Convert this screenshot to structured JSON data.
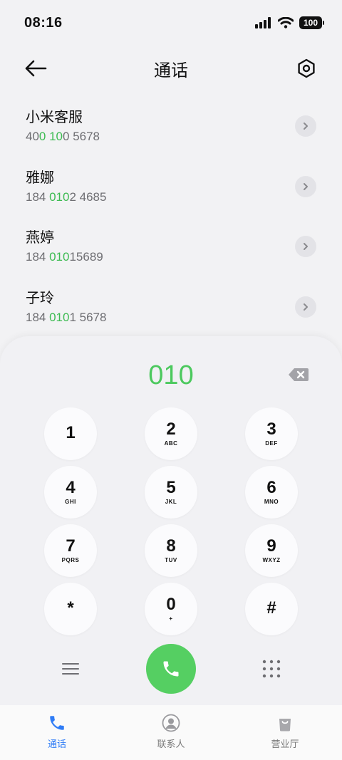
{
  "status_bar": {
    "time": "08:16",
    "battery": "100"
  },
  "header": {
    "title": "通话"
  },
  "contacts": [
    {
      "name": "小米客服",
      "number_parts": [
        "40",
        "0 10",
        "0 5678"
      ]
    },
    {
      "name": "雅娜",
      "number_parts": [
        "184 ",
        "010",
        "2 4685"
      ]
    },
    {
      "name": "燕婷",
      "number_parts": [
        "184 ",
        "010",
        "15689"
      ]
    },
    {
      "name": "子玲",
      "number_parts": [
        "184 ",
        "010",
        "1 5678"
      ]
    }
  ],
  "dialer": {
    "display": "010",
    "keys": [
      {
        "digit": "1",
        "letters": ""
      },
      {
        "digit": "2",
        "letters": "ABC"
      },
      {
        "digit": "3",
        "letters": "DEF"
      },
      {
        "digit": "4",
        "letters": "GHI"
      },
      {
        "digit": "5",
        "letters": "JKL"
      },
      {
        "digit": "6",
        "letters": "MNO"
      },
      {
        "digit": "7",
        "letters": "PQRS"
      },
      {
        "digit": "8",
        "letters": "TUV"
      },
      {
        "digit": "9",
        "letters": "WXYZ"
      },
      {
        "digit": "*",
        "letters": ""
      },
      {
        "digit": "0",
        "letters": "+"
      },
      {
        "digit": "#",
        "letters": ""
      }
    ]
  },
  "bottom_nav": {
    "items": [
      {
        "label": "通话",
        "icon": "phone-icon",
        "active": true
      },
      {
        "label": "联系人",
        "icon": "contact-icon",
        "active": false
      },
      {
        "label": "营业厅",
        "icon": "shopping-bag-icon",
        "active": false
      }
    ]
  },
  "colors": {
    "highlight": "#3dbb52",
    "call": "#55cf62",
    "active_tab": "#2f7cf6"
  }
}
